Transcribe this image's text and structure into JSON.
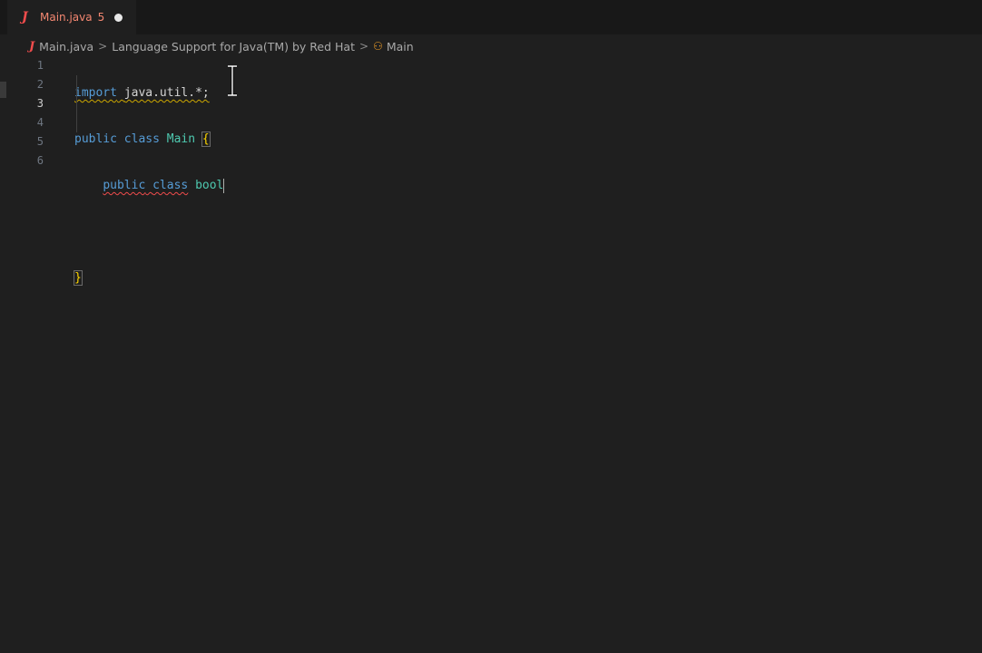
{
  "tab": {
    "icon": "java-icon",
    "icon_glyph": "J",
    "label": "Main.java",
    "problems": "5",
    "dirty_indicator": "unsaved-dot"
  },
  "breadcrumb": {
    "file_icon_glyph": "J",
    "file": "Main.java",
    "separator": ">",
    "extension": "Language Support for Java(TM) by Red Hat",
    "class_icon_glyph": "⚇",
    "class": "Main"
  },
  "editor": {
    "line_numbers": [
      "1",
      "2",
      "3",
      "4",
      "5",
      "6"
    ],
    "active_line": "3",
    "lines": {
      "l1": {
        "kw": "import",
        "space": " ",
        "pkg": "java.util.*;"
      },
      "l2": {
        "kw1": "public",
        "kw2": "class",
        "name": "Main",
        "brace": "{"
      },
      "l3": {
        "indent": "    ",
        "kw1": "public",
        "kw2": "class",
        "name": "bool"
      },
      "l5": {
        "brace": "}"
      }
    }
  },
  "colors": {
    "keyword": "#569cd6",
    "class_name": "#4ec9b0",
    "bracket": "#ffd700",
    "error": "#f14c4c",
    "warning": "#cca700"
  }
}
